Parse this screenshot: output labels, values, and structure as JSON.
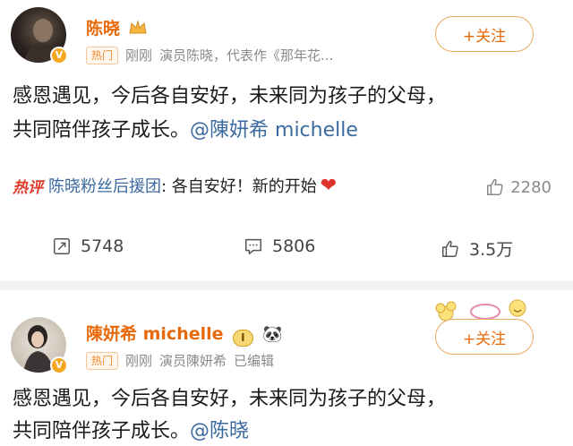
{
  "post1": {
    "author": "陈晓",
    "hot_tag": "热门",
    "time": "刚刚",
    "source": "演员陈晓，代表作《那年花...",
    "follow_label": "+关注",
    "text_line1": "感恩遇见，今后各自安好，未来同为孩子的父母，",
    "text_line2_prefix": "共同陪伴孩子成长。",
    "mention": "@陳妍希 michelle",
    "hot_comment": {
      "label": "热评",
      "commenter": "陈晓粉丝后援团",
      "text": ": 各自安好！新的开始",
      "likes": "2280"
    },
    "actions": {
      "repost": "5748",
      "comment": "5806",
      "like": "3.5万"
    }
  },
  "post2": {
    "author": "陳妍希 michelle",
    "hot_tag": "热门",
    "time": "刚刚",
    "source": "演员陳妍希",
    "edited": "已编辑",
    "follow_label": "+关注",
    "level_badge": "I",
    "text_line1": "感恩遇见，今后各自安好，未来同为孩子的父母，",
    "text_line2_prefix": "共同陪伴孩子成长。",
    "mention": "@陈晓"
  },
  "colors": {
    "name_orange": "#e8690a",
    "link_blue": "#3b6aa0",
    "hot_red": "#e03c2c"
  }
}
